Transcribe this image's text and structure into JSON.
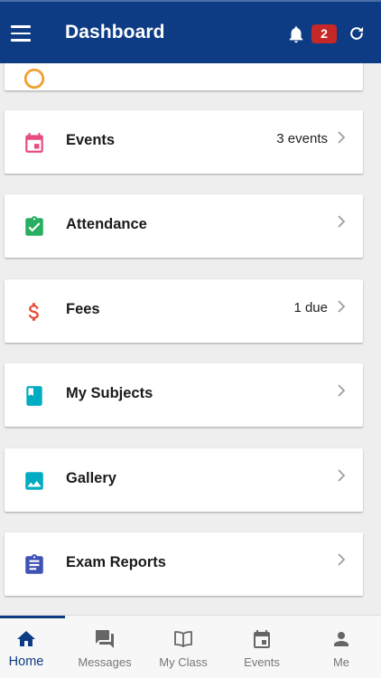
{
  "header": {
    "title": "Dashboard",
    "notification_count": "2",
    "bg_color": "#0d3c84"
  },
  "menu": [
    {
      "label": "",
      "value": "",
      "icon": "clock-icon",
      "color": "#f0a030"
    },
    {
      "label": "Events",
      "value": "3 events",
      "icon": "calendar-icon",
      "color": "#e84c7e"
    },
    {
      "label": "Attendance",
      "value": "",
      "icon": "clipboard-check-icon",
      "color": "#27ae60"
    },
    {
      "label": "Fees",
      "value": "1 due",
      "icon": "dollar-icon",
      "color": "#e74c3c"
    },
    {
      "label": "My Subjects",
      "value": "",
      "icon": "book-icon",
      "color": "#00acc1"
    },
    {
      "label": "Gallery",
      "value": "",
      "icon": "image-icon",
      "color": "#00acc1"
    },
    {
      "label": "Exam Reports",
      "value": "",
      "icon": "report-icon",
      "color": "#3f51b5"
    }
  ],
  "bottom_nav": [
    {
      "label": "Home",
      "icon": "home-icon",
      "active": true
    },
    {
      "label": "Messages",
      "icon": "messages-icon",
      "active": false
    },
    {
      "label": "My Class",
      "icon": "open-book-icon",
      "active": false
    },
    {
      "label": "Events",
      "icon": "calendar-icon",
      "active": false
    },
    {
      "label": "Me",
      "icon": "person-icon",
      "active": false
    }
  ]
}
